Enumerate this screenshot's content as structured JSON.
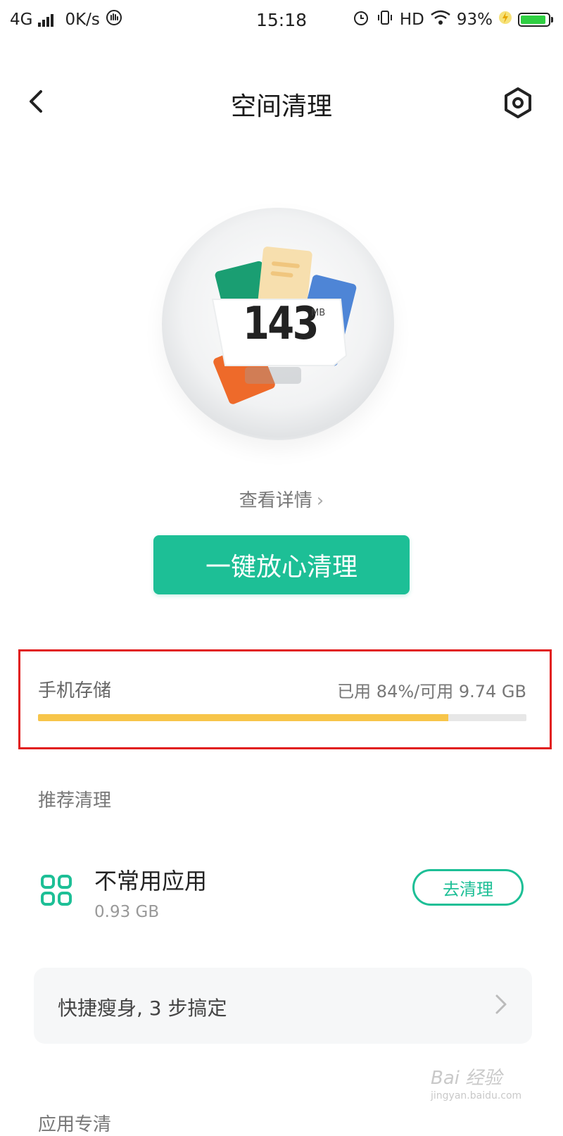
{
  "status_bar": {
    "network": "4G",
    "speed": "0K/s",
    "time": "15:18",
    "hd": "HD",
    "battery_text": "93%",
    "battery_level": 0.93,
    "icons": [
      "signal-icon",
      "hand-icon",
      "alarm-icon",
      "vibrate-icon",
      "wifi-icon",
      "charging-icon",
      "battery-icon"
    ]
  },
  "header": {
    "title": "空间清理",
    "back_icon": "back-arrow-icon",
    "settings_icon": "settings-icon"
  },
  "hero": {
    "size_value": "143",
    "size_unit": "MB",
    "details_link": "查看详情",
    "clean_button": "一键放心清理"
  },
  "storage": {
    "label": "手机存储",
    "stats": "已用 84%/可用 9.74 GB",
    "used_fraction": 0.84,
    "bar_color": "#f7c54a",
    "highlight_color": "#e11d1d"
  },
  "recommended": {
    "heading": "推荐清理",
    "items": [
      {
        "icon": "apps-grid-icon",
        "title": "不常用应用",
        "size": "0.93 GB",
        "action": "去清理"
      }
    ],
    "quick_slim": "快捷瘦身, 3 步搞定"
  },
  "app_specific": {
    "heading": "应用专清"
  },
  "watermark": {
    "text": "Bai 经验",
    "sub": "jingyan.baidu.com"
  },
  "colors": {
    "accent": "#1dbf96"
  }
}
